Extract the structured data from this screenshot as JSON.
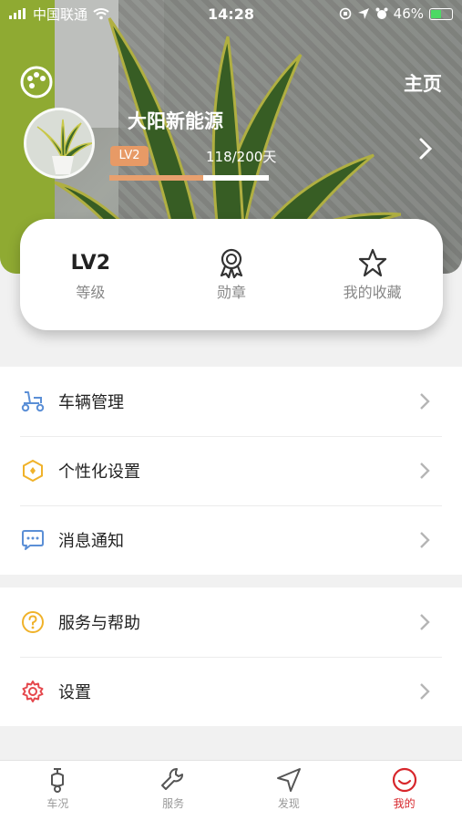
{
  "status_bar": {
    "carrier": "中国联通",
    "time": "14:28",
    "battery_percent": "46%",
    "battery_level": 0.46
  },
  "header": {
    "home_label": "主页",
    "username": "大阳新能源",
    "level_badge": "LV2",
    "days_progress_text": "118/200天",
    "progress_fraction": 0.59,
    "accent_color": "#e8a06e"
  },
  "stats": [
    {
      "value": "LV2",
      "label": "等级"
    },
    {
      "icon": "medal-icon",
      "label": "勋章"
    },
    {
      "icon": "star-icon",
      "label": "我的收藏"
    }
  ],
  "menu_group_1": [
    {
      "icon": "scooter-icon",
      "label": "车辆管理",
      "color": "#5b8fd6"
    },
    {
      "icon": "hexagon-icon",
      "label": "个性化设置",
      "color": "#f0b22a"
    },
    {
      "icon": "message-icon",
      "label": "消息通知",
      "color": "#5b8fd6"
    }
  ],
  "menu_group_2": [
    {
      "icon": "question-icon",
      "label": "服务与帮助",
      "color": "#f0b22a"
    },
    {
      "icon": "gear-icon",
      "label": "设置",
      "color": "#e5484d"
    }
  ],
  "tabs": [
    {
      "label": "车况",
      "icon": "scooter-tab-icon",
      "active": false
    },
    {
      "label": "服务",
      "icon": "wrench-icon",
      "active": false
    },
    {
      "label": "发现",
      "icon": "navigation-icon",
      "active": false
    },
    {
      "label": "我的",
      "icon": "smiley-icon",
      "active": true
    }
  ]
}
